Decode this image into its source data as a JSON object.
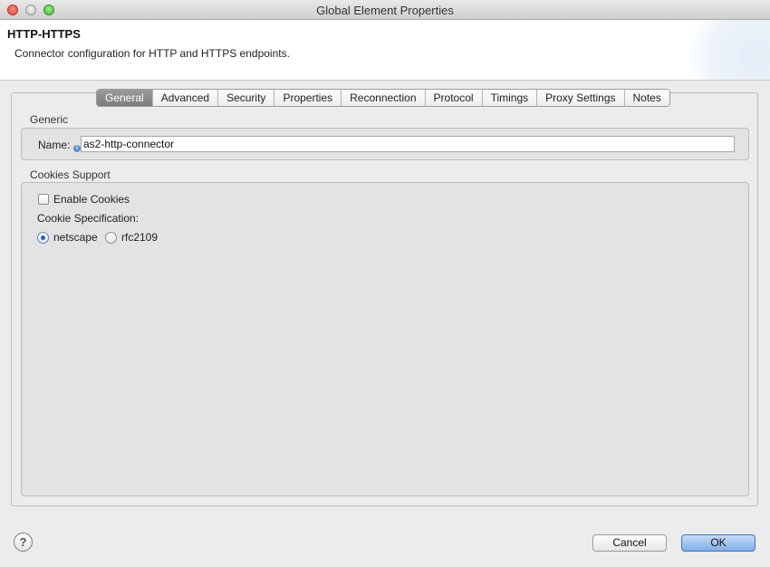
{
  "window": {
    "title": "Global Element Properties"
  },
  "header": {
    "title": "HTTP-HTTPS",
    "description": "Connector configuration for HTTP and HTTPS endpoints."
  },
  "tabs": [
    {
      "label": "General",
      "active": true
    },
    {
      "label": "Advanced",
      "active": false
    },
    {
      "label": "Security",
      "active": false
    },
    {
      "label": "Properties",
      "active": false
    },
    {
      "label": "Reconnection",
      "active": false
    },
    {
      "label": "Protocol",
      "active": false
    },
    {
      "label": "Timings",
      "active": false
    },
    {
      "label": "Proxy Settings",
      "active": false
    },
    {
      "label": "Notes",
      "active": false
    }
  ],
  "generic": {
    "label": "Generic",
    "name_label": "Name:",
    "name_value": "as2-http-connector"
  },
  "cookies": {
    "label": "Cookies Support",
    "enable_label": "Enable Cookies",
    "enable_checked": false,
    "spec_label": "Cookie Specification:",
    "options": [
      {
        "label": "netscape",
        "selected": true
      },
      {
        "label": "rfc2109",
        "selected": false
      }
    ]
  },
  "footer": {
    "help_glyph": "?",
    "cancel_label": "Cancel",
    "ok_label": "OK"
  }
}
